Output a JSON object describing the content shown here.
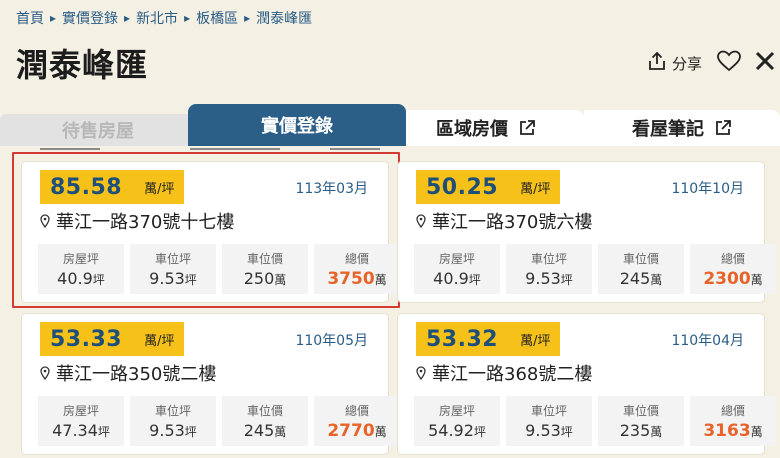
{
  "breadcrumb": [
    "首頁",
    "實價登錄",
    "新北市",
    "板橋區",
    "潤泰峰匯"
  ],
  "page_title": "潤泰峰匯",
  "actions": {
    "share_label": "分享"
  },
  "tabs": {
    "for_sale": "待售房屋",
    "actual_price": "實價登錄",
    "area_price": "區域房價",
    "notes": "看屋筆記"
  },
  "colors": {
    "accent": "#2c5f87",
    "badge": "#f6c21a",
    "total": "#e8632a",
    "highlight": "#d43a36"
  },
  "records": [
    {
      "price": "85.58",
      "price_unit": "萬/坪",
      "date": "113年03月",
      "address": "華江一路370號十七樓",
      "labels": [
        "房屋坪",
        "車位坪",
        "車位價",
        "總價"
      ],
      "house_ping": "40.9",
      "parking_ping": "9.53",
      "parking_price": "250",
      "total": "3750",
      "u_ping": "坪",
      "u_wan": "萬"
    },
    {
      "price": "50.25",
      "price_unit": "萬/坪",
      "date": "110年10月",
      "address": "華江一路370號六樓",
      "labels": [
        "房屋坪",
        "車位坪",
        "車位價",
        "總價"
      ],
      "house_ping": "40.9",
      "parking_ping": "9.53",
      "parking_price": "245",
      "total": "2300",
      "u_ping": "坪",
      "u_wan": "萬"
    },
    {
      "price": "53.33",
      "price_unit": "萬/坪",
      "date": "110年05月",
      "address": "華江一路350號二樓",
      "labels": [
        "房屋坪",
        "車位坪",
        "車位價",
        "總價"
      ],
      "house_ping": "47.34",
      "parking_ping": "9.53",
      "parking_price": "245",
      "total": "2770",
      "u_ping": "坪",
      "u_wan": "萬"
    },
    {
      "price": "53.32",
      "price_unit": "萬/坪",
      "date": "110年04月",
      "address": "華江一路368號二樓",
      "labels": [
        "房屋坪",
        "車位坪",
        "車位價",
        "總價"
      ],
      "house_ping": "54.92",
      "parking_ping": "9.53",
      "parking_price": "235",
      "total": "3163",
      "u_ping": "坪",
      "u_wan": "萬"
    }
  ]
}
